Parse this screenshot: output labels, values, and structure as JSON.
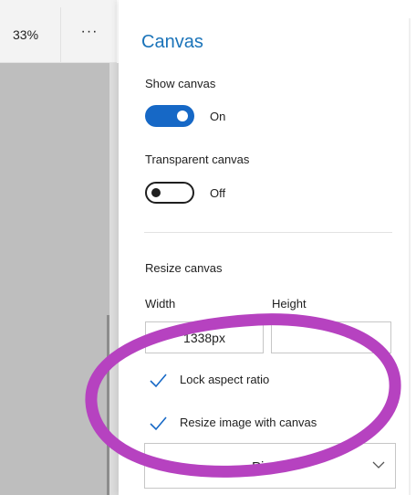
{
  "toolbar": {
    "zoom_level": "33%",
    "more_label": "···"
  },
  "panel": {
    "title": "Canvas",
    "show_canvas": {
      "label": "Show canvas",
      "state": "On",
      "enabled": true
    },
    "transparent_canvas": {
      "label": "Transparent canvas",
      "state": "Off",
      "enabled": false
    },
    "resize": {
      "label": "Resize canvas",
      "width_label": "Width",
      "height_label": "Height",
      "width_value": "1338px",
      "height_value": "",
      "lock_aspect_label": "Lock aspect ratio",
      "lock_aspect_checked": true,
      "resize_image_label": "Resize image with canvas",
      "resize_image_checked": true,
      "units_selected": "Pixels"
    }
  },
  "colors": {
    "accent": "#1668c6",
    "title": "#1a73b9",
    "annotation": "#b642c0",
    "canvas_gray": "#bebebe"
  },
  "icons": {
    "more": "more-icon",
    "check": "checkmark-icon",
    "chevron": "chevron-down-icon"
  }
}
